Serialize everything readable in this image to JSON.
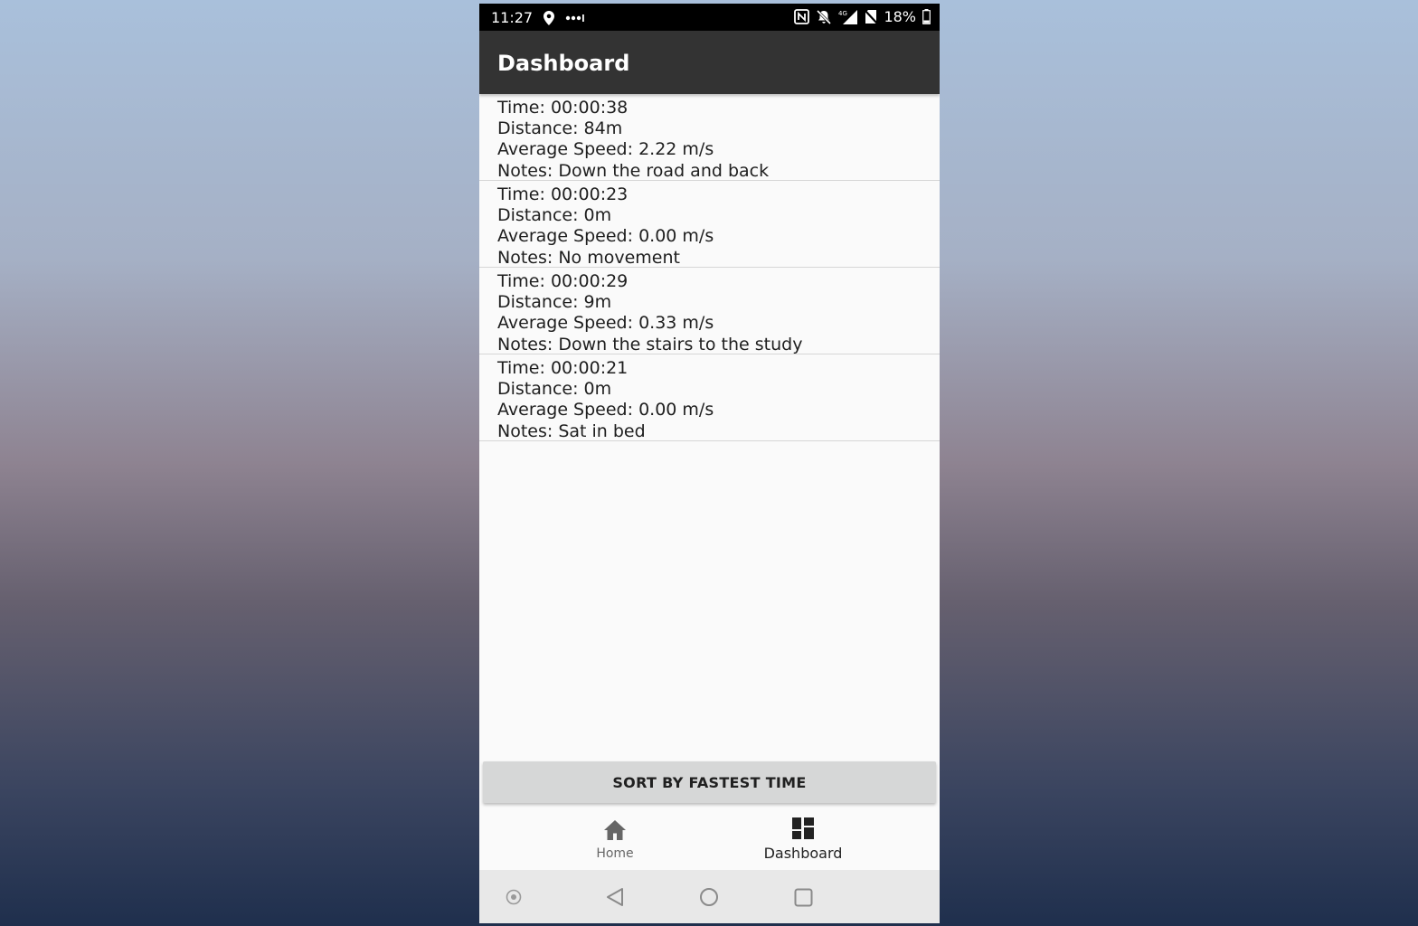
{
  "status_bar": {
    "time": "11:27",
    "battery": "18%",
    "network_type": "4G",
    "icons": [
      "location-icon",
      "more-dots-icon",
      "nfc-icon",
      "bell-off-icon",
      "signal-icon",
      "no-sim-icon",
      "battery-icon"
    ]
  },
  "app_bar": {
    "title": "Dashboard"
  },
  "entries": [
    {
      "time": "Time: 00:00:38",
      "distance": "Distance: 84m",
      "speed": "Average Speed: 2.22 m/s",
      "notes": "Notes: Down the road and back"
    },
    {
      "time": "Time: 00:00:23",
      "distance": "Distance: 0m",
      "speed": "Average Speed: 0.00 m/s",
      "notes": "Notes: No movement"
    },
    {
      "time": "Time: 00:00:29",
      "distance": "Distance: 9m",
      "speed": "Average Speed: 0.33 m/s",
      "notes": "Notes: Down the stairs to the study"
    },
    {
      "time": "Time: 00:00:21",
      "distance": "Distance: 0m",
      "speed": "Average Speed: 0.00 m/s",
      "notes": "Notes: Sat in bed"
    }
  ],
  "sort_button": {
    "label": "SORT BY FASTEST TIME"
  },
  "bottom_nav": {
    "items": [
      {
        "label": "Home",
        "icon": "home-icon",
        "selected": false
      },
      {
        "label": "Dashboard",
        "icon": "dashboard-icon",
        "selected": true
      }
    ]
  },
  "system_nav": {
    "icons": [
      "assist-icon",
      "back-icon",
      "home-circle-icon",
      "recents-icon"
    ]
  },
  "colors": {
    "app_bar": "#333333",
    "background": "#fafafa",
    "button": "#d6d7d7",
    "system_nav": "#e8e8e8"
  }
}
